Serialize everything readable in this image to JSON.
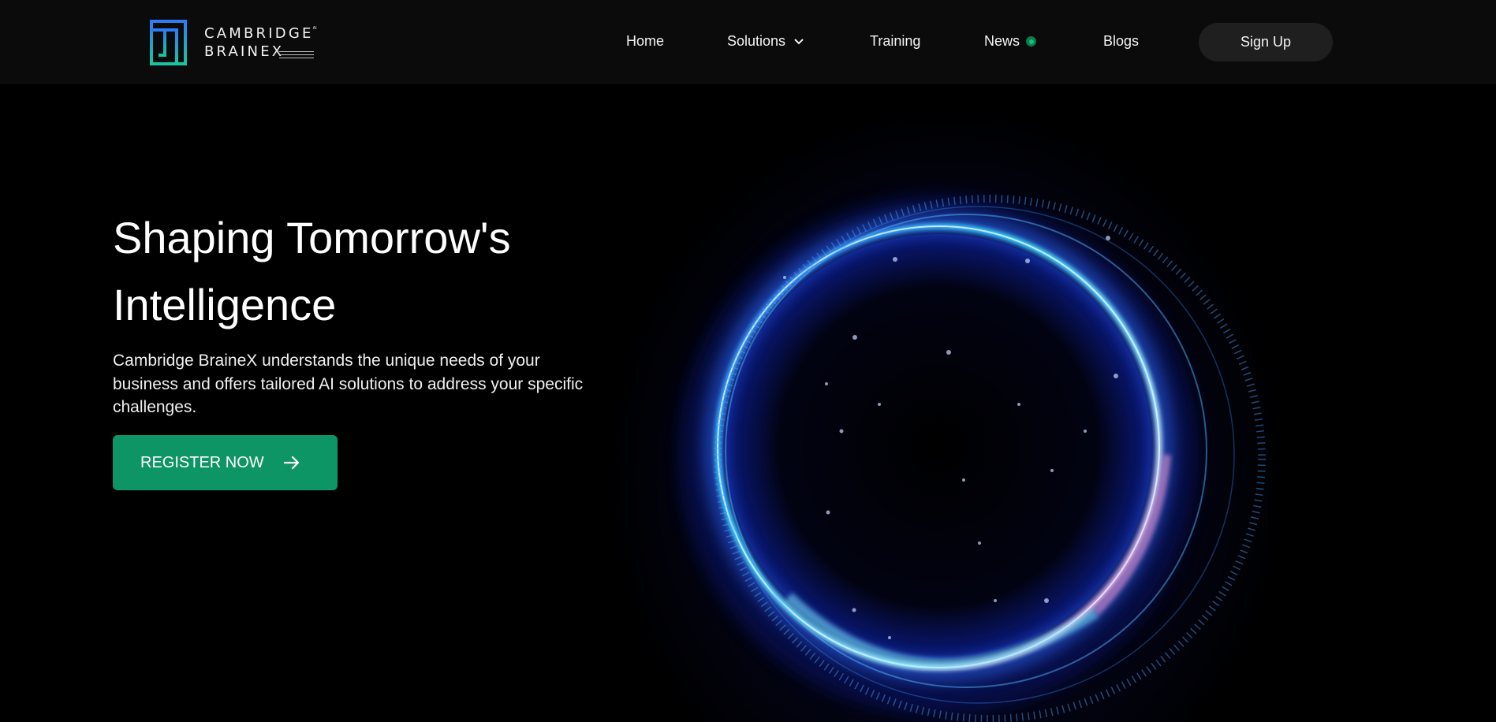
{
  "brand": {
    "name_line1": "CAMBRIDGE",
    "name_line2": "BRAINEX",
    "tm": "AI",
    "logo_icon": "maze-logo-icon",
    "colors": {
      "gradient_top": "#2f7cf6",
      "gradient_bottom": "#18c5a0"
    }
  },
  "nav": {
    "home": "Home",
    "solutions": "Solutions",
    "training": "Training",
    "news": "News",
    "blogs": "Blogs",
    "signup": "Sign Up"
  },
  "hero": {
    "title_line1": "Shaping Tomorrow's",
    "title_line2": "Intelligence",
    "description": "Cambridge BraineX understands the unique needs of your business and offers tailored AI solutions to address your specific challenges.",
    "cta": "REGISTER NOW",
    "cta_icon": "arrow-right-icon"
  },
  "colors": {
    "header_bg": "#0b0b0b",
    "page_bg": "#000000",
    "accent_green": "#0e9566",
    "news_indicator": "#19c07a",
    "signup_bg": "#1f1f1f"
  }
}
